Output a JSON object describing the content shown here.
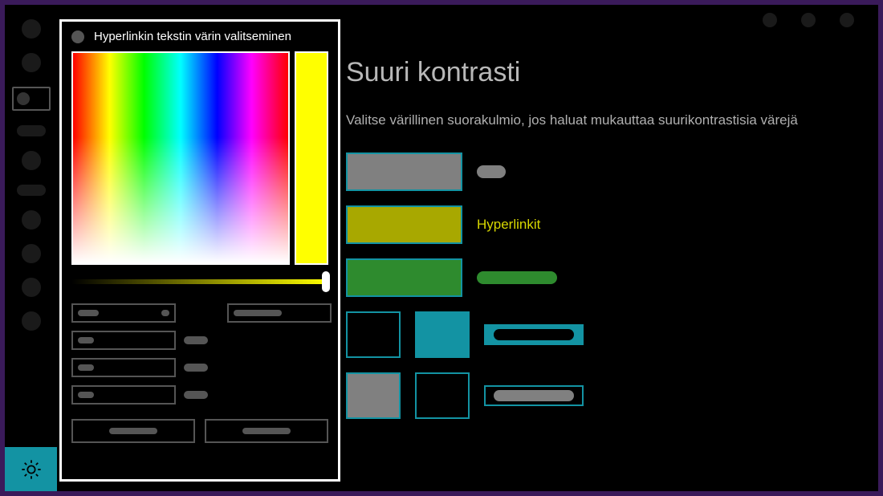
{
  "page": {
    "title": "Suuri kontrasti",
    "instruction": "Valitse värillinen suorakulmio, jos haluat mukauttaa suurikontrastisia värejä"
  },
  "swatches": {
    "row1": {
      "color": "#808080",
      "label_color": "#808080"
    },
    "row2": {
      "color": "#a8a800",
      "label": "Hyperlinkit",
      "label_color": "#d8d800"
    },
    "row3": {
      "color": "#2e8b2e",
      "label_color": "#2e8b2e"
    },
    "row4": {
      "bg1": "#000000",
      "bg2": "#1393a3",
      "label_bg": "#1393a3",
      "label_fg": "#000000"
    },
    "row5": {
      "bg1": "#808080",
      "bg2": "#000000",
      "label_bg": "#000000",
      "label_fg": "#808080"
    }
  },
  "picker": {
    "title": "Hyperlinkin tekstin värin valitseminen",
    "preview_color": "#ffff00",
    "slider_gradient_end": "#ffff00"
  },
  "colors": {
    "accent": "#1393a3",
    "border": "#ffffff"
  }
}
